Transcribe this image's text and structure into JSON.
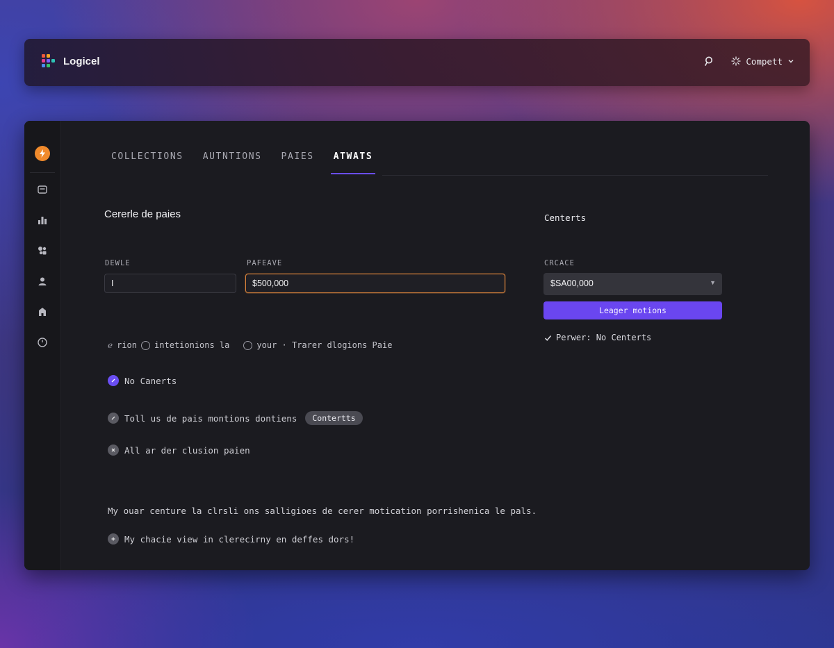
{
  "header": {
    "app_name": "Logicel",
    "account_label": "Compett"
  },
  "tabs": [
    {
      "label": "COLLECTIONS",
      "active": false
    },
    {
      "label": "AUTNTIONS",
      "active": false
    },
    {
      "label": "PAIES",
      "active": false
    },
    {
      "label": "ATWATS",
      "active": true
    }
  ],
  "main": {
    "section_title": "Cererle de paies",
    "field1": {
      "label": "DEWLE",
      "value": "I"
    },
    "field2": {
      "label": "PAFEAVE",
      "value": "$500,000"
    },
    "info": {
      "part1": "rion",
      "part2": "intetionions la",
      "part3": "your · Trarer dlogions Paie"
    },
    "bullets": {
      "item1": "No Canerts",
      "item2": "Toll us de pais montions dontiens",
      "item2_pill": "Contertts",
      "item3": "All ar der clusion paien"
    },
    "paragraph": "My ouar centure la clrsli ons salligioes de cerer motication porrishenica le pals.",
    "footer_note": "My chacie view in clerecirny en deffes dors!"
  },
  "right": {
    "title": "Centerts",
    "select_label": "CRCACE",
    "select_value": "$SA00,000",
    "button_label": "Leager motions",
    "status": "Perwer: No Centerts"
  },
  "colors": {
    "accent": "#6a46f0",
    "focus_border": "#d8823a",
    "brand_orange": "#f08a2c"
  }
}
